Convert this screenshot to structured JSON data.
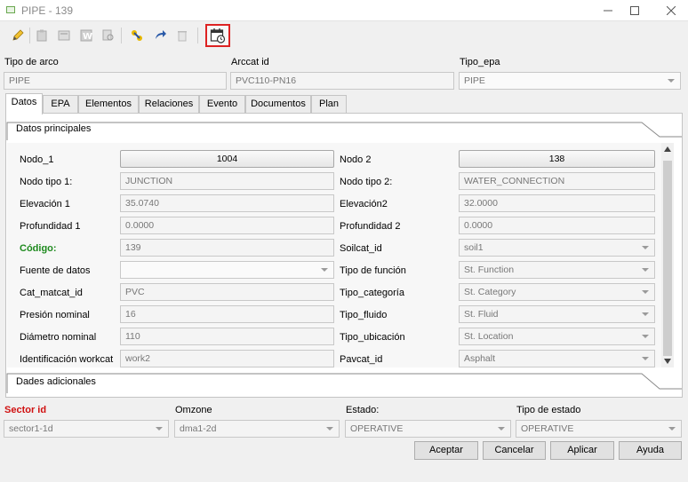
{
  "window": {
    "title": "PIPE - 139"
  },
  "header": {
    "tipo_arco": {
      "label": "Tipo de arco",
      "value": "PIPE"
    },
    "arccat_id": {
      "label": "Arccat id",
      "value": "PVC110-PN16"
    },
    "tipo_epa": {
      "label": "Tipo_epa",
      "value": "PIPE"
    }
  },
  "tabs": [
    "Datos",
    "EPA",
    "Elementos",
    "Relaciones",
    "Evento",
    "Documentos",
    "Plan"
  ],
  "groups": {
    "principal": "Datos principales",
    "adicional": "Dades adicionales"
  },
  "left": {
    "nodo1": {
      "label": "Nodo_1",
      "value": "1004"
    },
    "nodo_tipo1": {
      "label": "Nodo tipo 1:",
      "value": "JUNCTION"
    },
    "elevacion1": {
      "label": "Elevación 1",
      "value": "35.0740"
    },
    "profundidad1": {
      "label": "Profundidad 1",
      "value": "0.0000"
    },
    "codigo": {
      "label": "Código:",
      "value": "139"
    },
    "fuente": {
      "label": "Fuente de datos",
      "value": ""
    },
    "cat_matcat": {
      "label": "Cat_matcat_id",
      "value": "PVC"
    },
    "presion": {
      "label": "Presión nominal",
      "value": "16"
    },
    "diametro": {
      "label": "Diámetro nominal",
      "value": "110"
    },
    "workcat": {
      "label": "Identificación workcat",
      "value": "work2"
    }
  },
  "right": {
    "nodo2": {
      "label": "Nodo 2",
      "value": "138"
    },
    "nodo_tipo2": {
      "label": "Nodo tipo 2:",
      "value": "WATER_CONNECTION"
    },
    "elevacion2": {
      "label": "Elevación2",
      "value": "32.0000"
    },
    "profundidad2": {
      "label": "Profundidad 2",
      "value": "0.0000"
    },
    "soilcat": {
      "label": "Soilcat_id",
      "value": "soil1"
    },
    "tipo_funcion": {
      "label": "Tipo de función",
      "value": "St. Function"
    },
    "tipo_categoria": {
      "label": "Tipo_categoría",
      "value": "St. Category"
    },
    "tipo_fluido": {
      "label": "Tipo_fluido",
      "value": "St. Fluid"
    },
    "tipo_ubicacion": {
      "label": "Tipo_ubicación",
      "value": "St. Location"
    },
    "pavcat": {
      "label": "Pavcat_id",
      "value": "Asphalt"
    }
  },
  "footer": {
    "sector": {
      "label": "Sector id",
      "value": "sector1-1d"
    },
    "omzone": {
      "label": "Omzone",
      "value": "dma1-2d"
    },
    "estado": {
      "label": "Estado:",
      "value": "OPERATIVE"
    },
    "tipo_estado": {
      "label": "Tipo de estado",
      "value": "OPERATIVE"
    }
  },
  "buttons": {
    "accept": "Aceptar",
    "cancel": "Cancelar",
    "apply": "Aplicar",
    "help": "Ayuda"
  },
  "colors": {
    "required_label": "#d01010",
    "code_label": "#1e8a1e",
    "highlight": "#d22222"
  }
}
